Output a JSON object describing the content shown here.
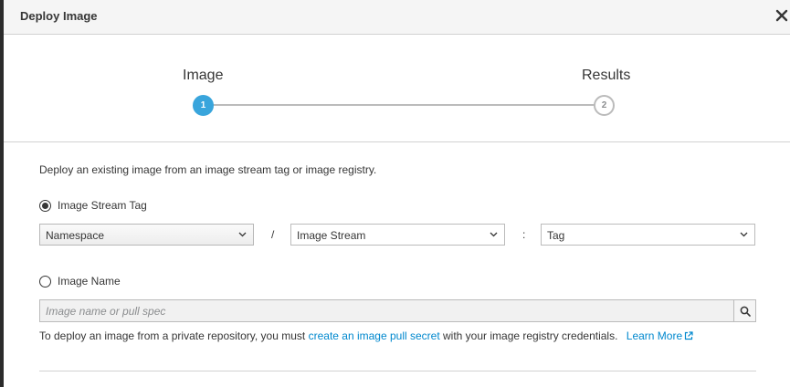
{
  "dialog": {
    "title": "Deploy Image"
  },
  "wizard": {
    "steps": [
      {
        "label": "Image",
        "number": "1",
        "state": "active"
      },
      {
        "label": "Results",
        "number": "2",
        "state": "inactive"
      }
    ]
  },
  "form": {
    "intro": "Deploy an existing image from an image stream tag or image registry.",
    "option_stream_tag": {
      "label": "Image Stream Tag",
      "selected": true
    },
    "namespace_select": {
      "value": "Namespace"
    },
    "separator_slash": "/",
    "image_stream_select": {
      "value": "Image Stream"
    },
    "separator_colon": ":",
    "tag_select": {
      "value": "Tag"
    },
    "option_image_name": {
      "label": "Image Name",
      "selected": false
    },
    "image_name_input": {
      "placeholder": "Image name or pull spec",
      "value": ""
    },
    "help": {
      "prefix": "To deploy an image from a private repository, you must ",
      "link": "create an image pull secret",
      "suffix": " with your image registry credentials.",
      "learn_more": "Learn More"
    }
  },
  "colors": {
    "accent": "#39a5dc",
    "link": "#0088ce",
    "header_bg": "#f5f5f5",
    "border": "#bbbbbb"
  },
  "icons": {
    "close": "close-icon",
    "search": "search-icon",
    "chevron": "chevron-down-icon",
    "external": "external-link-icon"
  }
}
